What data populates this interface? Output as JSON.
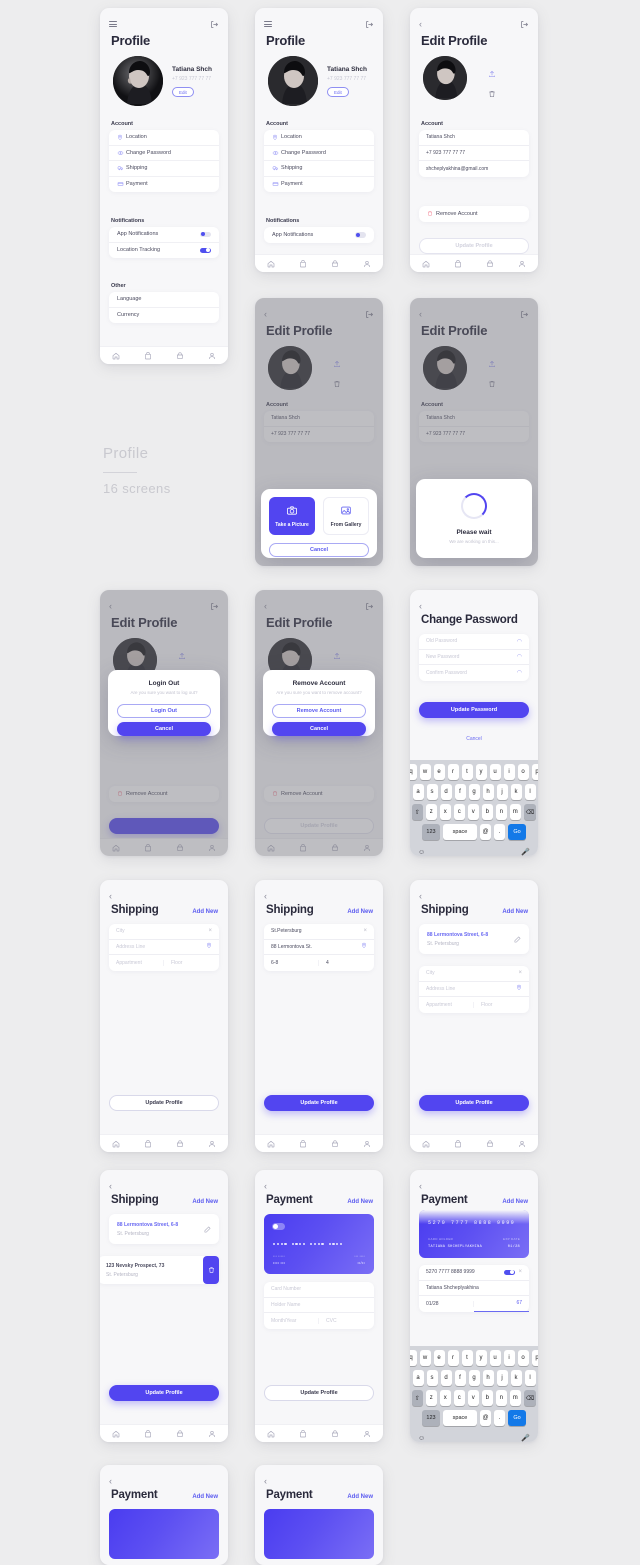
{
  "poster": {
    "title": "Profile",
    "subtitle": "16 screens"
  },
  "user": {
    "name": "Tatiana Shch",
    "phone": "+7 923 777 77 77",
    "email": "shcheplyakhina@gmail.com",
    "edit_pill": "Edit"
  },
  "nav": {
    "items": [
      "home-icon",
      "bag-icon",
      "basket-icon",
      "person-icon"
    ]
  },
  "screens": {
    "profile": {
      "title": "Profile",
      "sections": [
        {
          "heading": "Account",
          "items": [
            {
              "icon": "location-pin-icon",
              "label": "Location"
            },
            {
              "icon": "eye-icon",
              "label": "Change Password"
            },
            {
              "icon": "truck-icon",
              "label": "Shipping"
            },
            {
              "icon": "card-icon",
              "label": "Payment"
            }
          ]
        },
        {
          "heading": "Notifications",
          "items": [
            {
              "label": "App Notifications",
              "toggle": "off"
            },
            {
              "label": "Location Tracking",
              "toggle": "on"
            }
          ]
        },
        {
          "heading": "Other",
          "items": [
            {
              "label": "Language"
            },
            {
              "label": "Currency"
            }
          ]
        }
      ]
    },
    "profile_scrolled": {
      "title": "Profile",
      "account_heading": "Account",
      "notifications_heading": "Notifications",
      "items": [
        "Location",
        "Change Password",
        "Shipping",
        "Payment"
      ],
      "notification_item": "App Notifications"
    },
    "edit_profile": {
      "title": "Edit Profile",
      "account_heading": "Account",
      "fields": [
        {
          "name": "full-name",
          "value": "Tatiana Shch"
        },
        {
          "name": "phone",
          "value": "+7 923 777 77 77"
        },
        {
          "name": "email",
          "value": "shcheplyakhina@gmail.com"
        }
      ],
      "remove_account": "Remove Account",
      "update_button": "Update Profile",
      "upload_icon": "upload-icon",
      "trash_icon": "trash-icon"
    },
    "photo_source": {
      "take_picture": "Take a Picture",
      "from_gallery": "From Gallery",
      "cancel": "Cancel"
    },
    "please_wait": {
      "title": "Please wait",
      "subtitle": "We are working on this..."
    },
    "logout_dialog": {
      "title": "Login Out",
      "message": "Are you sure you want to log out?",
      "confirm": "Login Out",
      "cancel": "Cancel"
    },
    "remove_dialog": {
      "title": "Remove Account",
      "message": "Are you sure you want to remove account?",
      "confirm": "Remove Account",
      "cancel": "Cancel"
    },
    "change_password": {
      "title": "Change Password",
      "fields": [
        "Old Password",
        "New Password",
        "Confirm Password"
      ],
      "update_button": "Update Password",
      "cancel": "Cancel"
    },
    "shipping_empty": {
      "title": "Shipping",
      "add_new": "Add New",
      "fields": [
        "City",
        "Address Line",
        "Appartment",
        "Floor"
      ],
      "update_button": "Update Profile"
    },
    "shipping_filled": {
      "title": "Shipping",
      "add_new": "Add New",
      "city": "St.Petersburg",
      "address": "88 Lermontova St.",
      "appartment": "6-8",
      "floor": "4",
      "update_button": "Update Profile"
    },
    "shipping_saved": {
      "title": "Shipping",
      "add_new": "Add New",
      "saved": {
        "line1": "88 Lermontova Street, 6-8",
        "line2": "St. Petersburg"
      },
      "fields": [
        "City",
        "Address Line",
        "Appartment",
        "Floor"
      ],
      "update_button": "Update Profile"
    },
    "shipping_list": {
      "title": "Shipping",
      "add_new": "Add New",
      "addresses": [
        {
          "line1": "88 Lermontova Street, 6-8",
          "line2": "St. Petersburg"
        },
        {
          "line1": "123 Nevsky Prospect, 73",
          "line2": "St. Petersburg"
        }
      ],
      "update_button": "Update Profile"
    },
    "payment_empty": {
      "title": "Payment",
      "add_new": "Add New",
      "fields": [
        "Card Number",
        "Holder Name",
        "Month/Year",
        "CVC"
      ],
      "update_button": "Update Profile"
    },
    "payment_filled": {
      "title": "Payment",
      "add_new": "Add New",
      "card": {
        "number": "5270 7777 8888 9999",
        "holder_label": "CARD HOLDER",
        "holder": "TATIANA SHCHEPLYAKHINA",
        "exp_label": "EXP DATE",
        "exp": "01/28"
      },
      "saved_number": "5270 7777 8888 9999",
      "holder_name": "Tatiana Shcheplyakhina",
      "month_year": "01/28",
      "cvc": "67"
    },
    "payment_bottom_a": {
      "title": "Payment",
      "add_new": "Add New"
    },
    "payment_bottom_b": {
      "title": "Payment",
      "add_new": "Add New"
    }
  },
  "keyboard": {
    "row1": [
      "q",
      "w",
      "e",
      "r",
      "t",
      "y",
      "u",
      "i",
      "o",
      "p"
    ],
    "row2": [
      "a",
      "s",
      "d",
      "f",
      "g",
      "h",
      "j",
      "k",
      "l"
    ],
    "row3": [
      "z",
      "x",
      "c",
      "v",
      "b",
      "n",
      "m"
    ],
    "shift": "shift-icon",
    "backspace": "backspace-icon",
    "numbers": "123",
    "space": "space",
    "at": "@",
    "dot": ".",
    "go": "Go",
    "emoji": "emoji-icon",
    "mic": "mic-icon"
  },
  "colors": {
    "accent": "#5245f0",
    "accent_light": "#8b8bf5",
    "bg": "#ededee",
    "card": "#ffffff",
    "danger": "#f48a9b"
  }
}
